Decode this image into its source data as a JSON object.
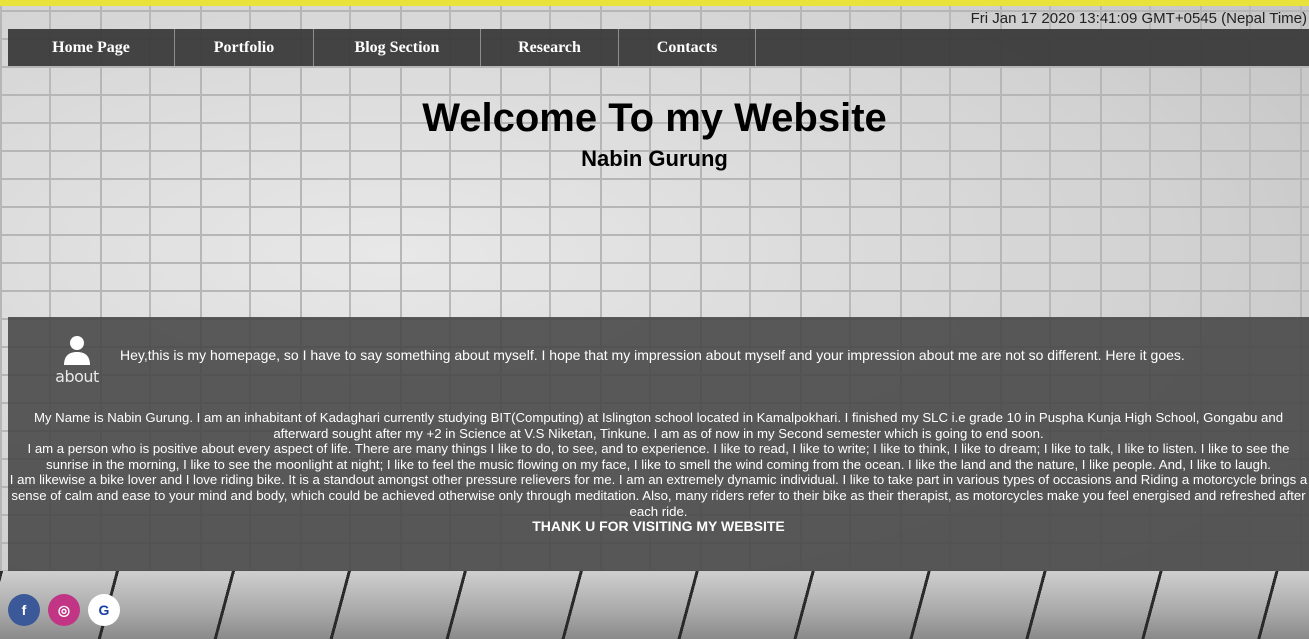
{
  "datetime": "Fri Jan 17 2020 13:41:09 GMT+0545 (Nepal Time)",
  "nav": {
    "items": [
      "Home Page",
      "Portfolio",
      "Blog Section",
      "Research",
      "Contacts"
    ]
  },
  "hero": {
    "title": "Welcome To my Website",
    "subtitle": "Nabin Gurung"
  },
  "about": {
    "label": "about",
    "intro": "Hey,this is my homepage, so I have to say something about myself. I hope that my impression about myself and your impression about me are not so different. Here it goes.",
    "paragraphs": [
      "My Name is Nabin Gurung. I am an inhabitant of Kadaghari currently studying BIT(Computing) at Islington school located in Kamalpokhari. I finished my SLC i.e grade 10 in Puspha Kunja High School, Gongabu and afterward sought after my +2 in Science at V.S Niketan, Tinkune. I am as of now in my Second semester which is going to end soon.",
      "I am a person who is positive about every aspect of life. There are many things I like to do, to see, and to experience. I like to read, I like to write; I like to think, I like to dream; I like to talk, I like to listen. I like to see the sunrise in the morning, I like to see the moonlight at night; I like to feel the music flowing on my face, I like to smell the wind coming from the ocean. I like the land and the nature, I like people. And, I like to laugh.",
      "I am likewise a bike lover and I love riding bike. It is a standout amongst other pressure relievers for me. I am an extremely dynamic individual. I like to take part in various types of occasions and Riding a motorcycle brings a sense of calm and ease to your mind and body, which could be achieved otherwise only through meditation. Also, many riders refer to their bike as their therapist, as motorcycles make you feel energised and refreshed after each ride."
    ],
    "thanks": "THANK U FOR VISITING MY WEBSITE"
  },
  "socials": [
    {
      "icon": "facebook-icon",
      "glyph": "f",
      "color": "#3b5998"
    },
    {
      "icon": "instagram-icon",
      "glyph": "◎",
      "color": "#c13584"
    },
    {
      "icon": "google-icon",
      "glyph": "G",
      "color": "#ffffff"
    }
  ],
  "colors": {
    "top_stripe": "#e9e23a",
    "navbar": "#3c3c3c",
    "about_panel": "#464646"
  }
}
